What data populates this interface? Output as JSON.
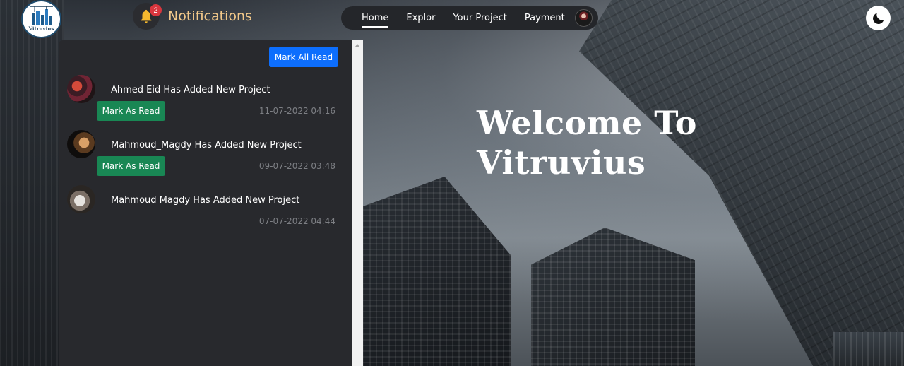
{
  "logo": {
    "text": "Vitruvius"
  },
  "header": {
    "notifications_title": "Notifications",
    "badge_count": "2"
  },
  "nav": {
    "items": [
      {
        "label": "Home",
        "active": true
      },
      {
        "label": "Explor",
        "active": false
      },
      {
        "label": "Your Project",
        "active": false
      },
      {
        "label": "Payment",
        "active": false
      }
    ]
  },
  "panel": {
    "mark_all_label": "Mark All Read",
    "notifications": [
      {
        "text": "Ahmed Eid Has Added New Project",
        "date": "11-07-2022 04:16",
        "button": "Mark As Read"
      },
      {
        "text": "Mahmoud_Magdy Has Added New Project",
        "date": "09-07-2022 03:48",
        "button": "Mark As Read"
      },
      {
        "text": "Mahmoud Magdy Has Added New Project",
        "date": "07-07-2022 04:44"
      }
    ]
  },
  "hero": {
    "line1": "Welcome To",
    "line2": "Vitruvius"
  },
  "colors": {
    "notif_title": "#f3c98a",
    "badge": "#d9363e",
    "mark_all_button": "#0d6efd",
    "mark_read_button": "#198754",
    "panel_bg": "#28292d",
    "nav_bg": "#24262a"
  },
  "icons": {
    "bell": "bell-icon",
    "moon": "moon-icon",
    "logo": "crane-logo-icon"
  }
}
